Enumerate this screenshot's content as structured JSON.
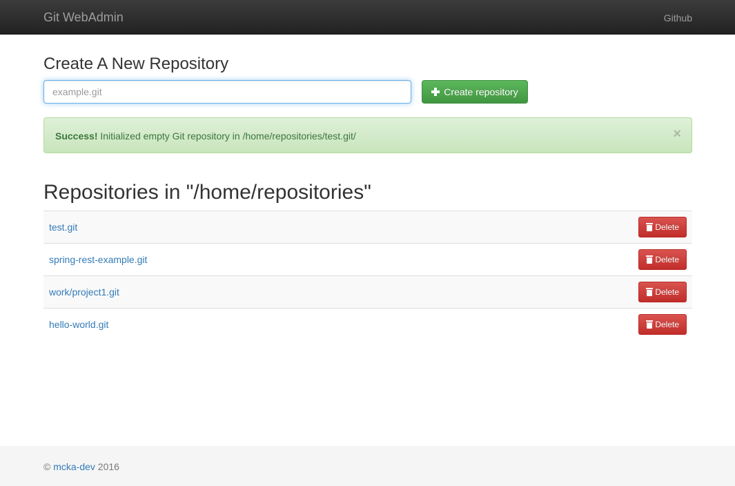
{
  "navbar": {
    "brand": "Git WebAdmin",
    "github_link": "Github"
  },
  "create": {
    "heading": "Create A New Repository",
    "input_placeholder": "example.git",
    "input_value": "",
    "button_label": "Create repository",
    "button_icon": "plus-icon"
  },
  "alert": {
    "type": "success",
    "strong": "Success!",
    "message": " Initialized empty Git repository in /home/repositories/test.git/",
    "close": "×"
  },
  "repositories": {
    "heading": "Repositories in \"/home/repositories\"",
    "items": [
      {
        "name": "test.git",
        "delete_label": "Delete"
      },
      {
        "name": "spring-rest-example.git",
        "delete_label": "Delete"
      },
      {
        "name": "work/project1.git",
        "delete_label": "Delete"
      },
      {
        "name": "hello-world.git",
        "delete_label": "Delete"
      }
    ]
  },
  "footer": {
    "copyright": "©",
    "author": "mcka-dev",
    "year": "2016"
  },
  "colors": {
    "navbar": "#222222",
    "success_button": "#5cb85c",
    "danger_button": "#d9534f",
    "link": "#337ab7",
    "alert_bg": "#dff0d8",
    "alert_text": "#3c763d"
  }
}
